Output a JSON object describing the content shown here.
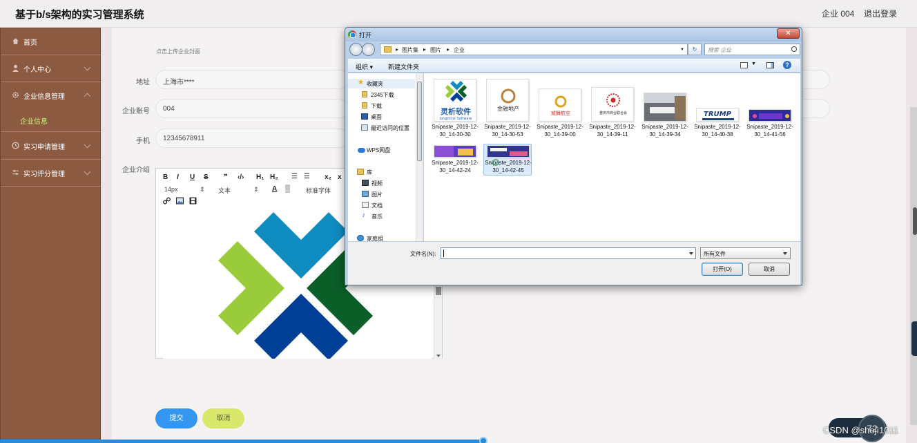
{
  "header": {
    "title": "基于b/s架构的实习管理系统",
    "user": "企业 004",
    "logout": "退出登录"
  },
  "sidebar": {
    "items": [
      {
        "label": "首页",
        "icon": "home-icon"
      },
      {
        "label": "个人中心",
        "icon": "user-icon"
      },
      {
        "label": "企业信息管理",
        "icon": "gear-icon"
      },
      {
        "label": "实习申请管理",
        "icon": "clock-icon"
      },
      {
        "label": "实习评分管理",
        "icon": "sliders-icon"
      }
    ],
    "sub_item": "企业信息"
  },
  "form": {
    "cover_hint": "点击上传企业封面",
    "address_label": "地址",
    "address_value": "上海市****",
    "account_label": "企业账号",
    "account_value": "004",
    "phone_label": "手机",
    "phone_value": "12345678911",
    "intro_label": "企业介绍"
  },
  "editor": {
    "font_size": "14px",
    "text_type": "文本",
    "font_family": "标准字体"
  },
  "buttons": {
    "submit": "提交",
    "cancel": "取消"
  },
  "dialog": {
    "title": "打开",
    "breadcrumb": [
      "图片集",
      "图片",
      "企业"
    ],
    "search_placeholder": "搜索 企业",
    "organize": "组织 ▾",
    "new_folder": "新建文件夹",
    "help": "?",
    "nav": [
      {
        "label": "收藏夹",
        "icon": "star-icon"
      },
      {
        "label": "2345下载",
        "icon": "folder-icon"
      },
      {
        "label": "下载",
        "icon": "folder-icon"
      },
      {
        "label": "桌面",
        "icon": "desktop-icon"
      },
      {
        "label": "最近访问的位置",
        "icon": "recent-icon"
      },
      {
        "label": "WPS网盘",
        "icon": "cloud-icon"
      },
      {
        "label": "库",
        "icon": "library-icon"
      },
      {
        "label": "视频",
        "icon": "video-icon"
      },
      {
        "label": "图片",
        "icon": "picture-icon"
      },
      {
        "label": "文档",
        "icon": "document-icon"
      },
      {
        "label": "音乐",
        "icon": "music-icon"
      },
      {
        "label": "家庭组",
        "icon": "homegroup-icon"
      }
    ],
    "files": [
      {
        "name": "Snipaste_2019-12-30_14-30-30"
      },
      {
        "name": "Snipaste_2019-12-30_14-30-53"
      },
      {
        "name": "Snipaste_2019-12-30_14-39-00"
      },
      {
        "name": "Snipaste_2019-12-30_14-39-11"
      },
      {
        "name": "Snipaste_2019-12-30_14-39-34"
      },
      {
        "name": "Snipaste_2019-12-30_14-40-38"
      },
      {
        "name": "Snipaste_2019-12-30_14-41-56"
      },
      {
        "name": "Snipaste_2019-12-30_14-42-24"
      },
      {
        "name": "Snipaste_2019-12-30_14-42-45"
      }
    ],
    "thumb_texts": {
      "lingxi": "灵析软件",
      "lingxi_en": "longthink Software",
      "jinrong": "金融地产",
      "weiyu": "威舞航空",
      "zhongqing": "重庆市商业联合会",
      "trump": "TRUMP"
    },
    "filename_label": "文件名(N):",
    "filename_value": "",
    "filetype": "所有文件",
    "open": "打开(O)",
    "cancel": "取消"
  },
  "overlay": {
    "watermark": "CSDN @shejì1011",
    "speed": "72"
  }
}
